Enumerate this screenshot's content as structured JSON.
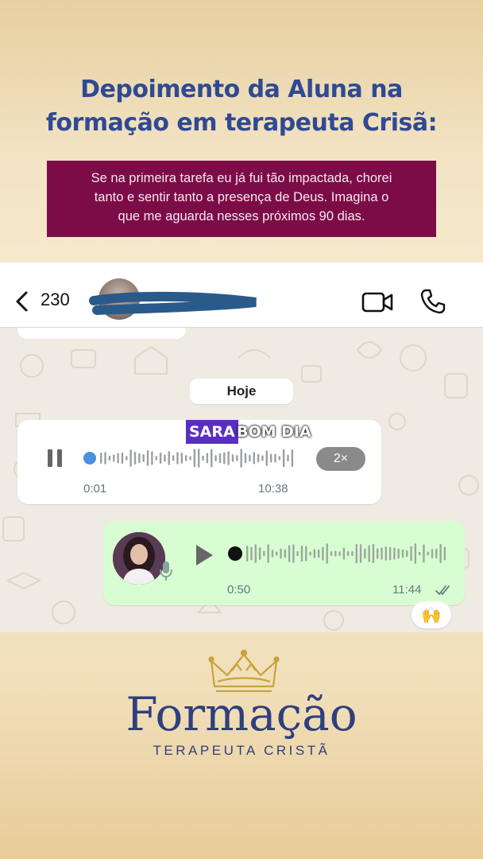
{
  "headline": {
    "line1": "Depoimento da Aluna na",
    "line2": "formação em terapeuta Crisã:"
  },
  "testimonial": {
    "line1": "Se na primeira tarefa eu já fui tão impactada, chorei",
    "line2": "tanto e sentir tanto a presença de Deus. Imagina o",
    "line3": "que me aguarda nesses próximos 90 dias."
  },
  "chat_header": {
    "back_icon": "chevron-left-icon",
    "unread_count": "230",
    "video_icon": "video-camera-icon",
    "call_icon": "phone-icon"
  },
  "date_chip": "Hoje",
  "caption": {
    "part1": "SARA",
    "part2": "BOM DIA"
  },
  "incoming_audio": {
    "state_icon": "pause-icon",
    "elapsed": "0:01",
    "time": "10:38",
    "speed": "2×",
    "progress": 0.0
  },
  "outgoing_audio": {
    "state_icon": "play-icon",
    "elapsed": "0:50",
    "time": "11:44",
    "status_icon": "double-check-icon",
    "progress": 0.0
  },
  "reaction": "🙌",
  "brand": {
    "title": "Formação",
    "subtitle": "TERAPEUTA CRISTÃ",
    "logo_icon": "crown-icon"
  },
  "colors": {
    "headline": "#2f4a93",
    "testimonial_bg": "#7c0c48",
    "outgoing_bubble": "#d9fdd3",
    "chat_bg": "#efeae2",
    "brand": "#2f3f7e",
    "caption_highlight": "#5a2fc0"
  }
}
